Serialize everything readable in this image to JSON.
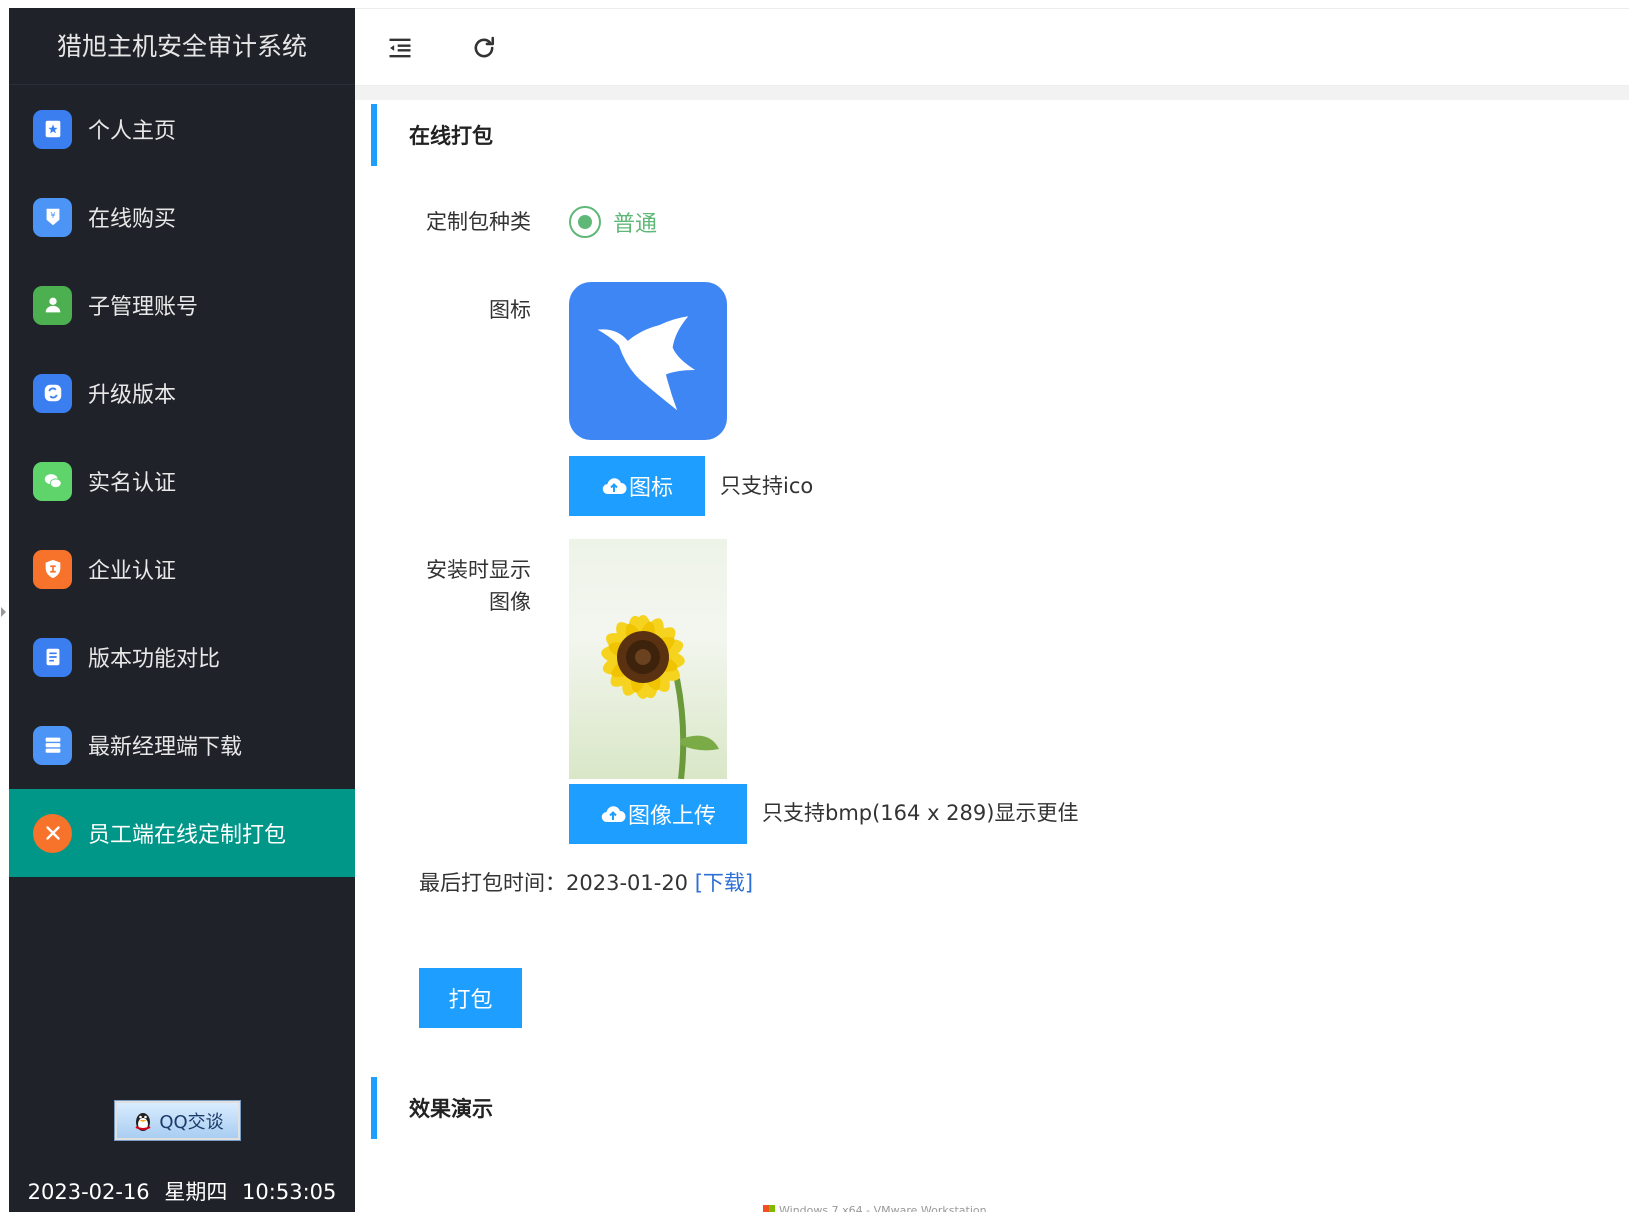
{
  "app": {
    "title": "猎旭主机安全审计系统"
  },
  "sidebar": {
    "items": [
      {
        "label": "个人主页",
        "icon": "home-icon",
        "color": "#3a7ef0"
      },
      {
        "label": "在线购买",
        "icon": "purchase-icon",
        "color": "#4d94f7"
      },
      {
        "label": "子管理账号",
        "icon": "user-icon",
        "color": "#4caf50"
      },
      {
        "label": "升级版本",
        "icon": "upgrade-icon",
        "color": "#3a7ef0"
      },
      {
        "label": "实名认证",
        "icon": "wechat-icon",
        "color": "#5ed46b"
      },
      {
        "label": "企业认证",
        "icon": "shield-icon",
        "color": "#f7722a"
      },
      {
        "label": "版本功能对比",
        "icon": "document-icon",
        "color": "#3a7ef0"
      },
      {
        "label": "最新经理端下载",
        "icon": "server-icon",
        "color": "#4d94f7"
      },
      {
        "label": "员工端在线定制打包",
        "icon": "tools-icon",
        "color": "#f7722a",
        "active": true
      }
    ],
    "qq_button": "QQ交谈",
    "clock": {
      "date": "2023-02-16",
      "weekday": "星期四",
      "time": "10:53:05"
    }
  },
  "header": {
    "menu_toggle_icon": "indent-icon",
    "refresh_icon": "refresh-icon"
  },
  "colors": {
    "sidebar_bg": "#20222a",
    "active_bg": "#009688",
    "primary": "#1e9fff",
    "radio": "#5fb878",
    "link": "#2d6fd6"
  },
  "form": {
    "section_title": "在线打包",
    "package_type_label": "定制包种类",
    "package_type_value": "普通",
    "icon_label": "图标",
    "icon_upload_button": "图标",
    "icon_hint": "只支持ico",
    "install_image_label_line1": "安装时显示",
    "install_image_label_line2": "图像",
    "image_upload_button": "图像上传",
    "image_hint": "只支持bmp(164 x 289)显示更佳",
    "last_pack_label": "最后打包时间：",
    "last_pack_date": "2023-01-20",
    "download_link": "[下载]",
    "pack_button": "打包"
  },
  "demo": {
    "section_title": "效果演示",
    "caption": "Windows 7 x64 - VMware Workstation"
  }
}
